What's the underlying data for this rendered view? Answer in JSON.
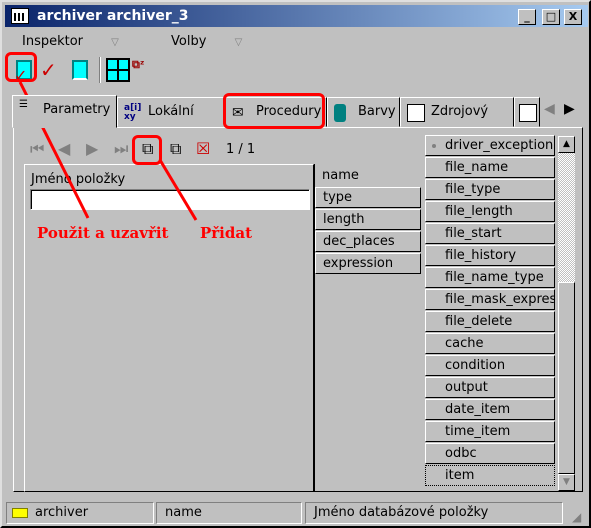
{
  "window": {
    "title": "archiver archiver_3",
    "controls": [
      "_",
      "□",
      "X"
    ]
  },
  "menu": [
    {
      "label": "Inspektor",
      "accel": "I"
    },
    {
      "label": "Volby",
      "accel": "V"
    }
  ],
  "toolbar": [
    {
      "icon": "apply-close-icon"
    },
    {
      "icon": "check-icon"
    },
    {
      "icon": "door-icon"
    },
    {
      "icon": "grid-icon"
    },
    {
      "icon": "sort-az-icon"
    }
  ],
  "tabs": [
    {
      "label": "Parametry",
      "icon": "list-icon",
      "active": true
    },
    {
      "label": "Lokální data",
      "icon": "local-data-icon"
    },
    {
      "label": "Procedury",
      "icon": "proc-icon"
    },
    {
      "label": "Barvy",
      "icon": "paint-icon"
    },
    {
      "label": "Zdrojový text",
      "icon": "source-icon"
    }
  ],
  "nav": {
    "pager": "1 / 1"
  },
  "form": {
    "field_label": "Jméno položky",
    "field_value": ""
  },
  "middle_items": [
    "name",
    "type",
    "length",
    "dec_places",
    "expression"
  ],
  "list_items": [
    "driver_exception",
    "file_name",
    "file_type",
    "file_length",
    "file_start",
    "file_history",
    "file_name_type",
    "file_mask_expressi",
    "file_delete",
    "cache",
    "condition",
    "output",
    "date_item",
    "time_item",
    "odbc",
    "item"
  ],
  "status": {
    "object": "archiver",
    "field": "name",
    "description": "Jméno databázové položky"
  },
  "annotations": {
    "apply_close": "Použit a uzavřit",
    "add": "Přidat",
    "color": "#ff0000"
  }
}
